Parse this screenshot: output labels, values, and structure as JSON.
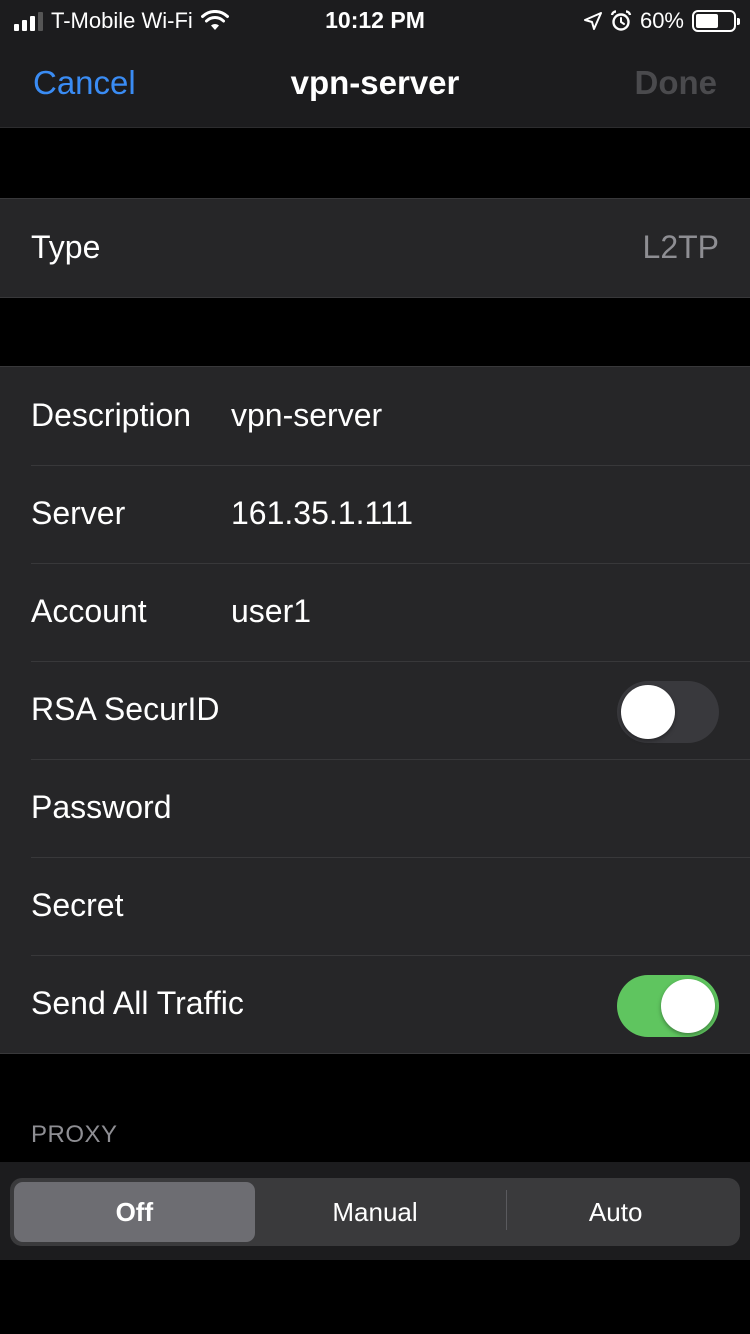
{
  "status_bar": {
    "carrier": "T-Mobile Wi-Fi",
    "time": "10:12 PM",
    "battery_percent": "60%",
    "battery_level": 0.6,
    "signal_bars": 3,
    "icons": [
      "cellular-signal-icon",
      "wifi-icon",
      "location-arrow-icon",
      "alarm-icon",
      "battery-icon"
    ]
  },
  "nav": {
    "cancel": "Cancel",
    "title": "vpn-server",
    "done": "Done"
  },
  "type_row": {
    "label": "Type",
    "value": "L2TP"
  },
  "fields": {
    "description": {
      "label": "Description",
      "value": "vpn-server"
    },
    "server": {
      "label": "Server",
      "value": "161.35.1.111"
    },
    "account": {
      "label": "Account",
      "value": "user1"
    },
    "rsa": {
      "label": "RSA SecurID",
      "on": false
    },
    "password": {
      "label": "Password",
      "value": ""
    },
    "secret": {
      "label": "Secret",
      "value": ""
    },
    "send_all": {
      "label": "Send All Traffic",
      "on": true
    }
  },
  "proxy": {
    "header": "PROXY",
    "options": [
      "Off",
      "Manual",
      "Auto"
    ],
    "selected": "Off"
  },
  "colors": {
    "accent": "#3a8cf4",
    "toggle_on": "#5fc55f",
    "toggle_off": "#39393d",
    "background": "#000000",
    "cell": "#262628"
  }
}
